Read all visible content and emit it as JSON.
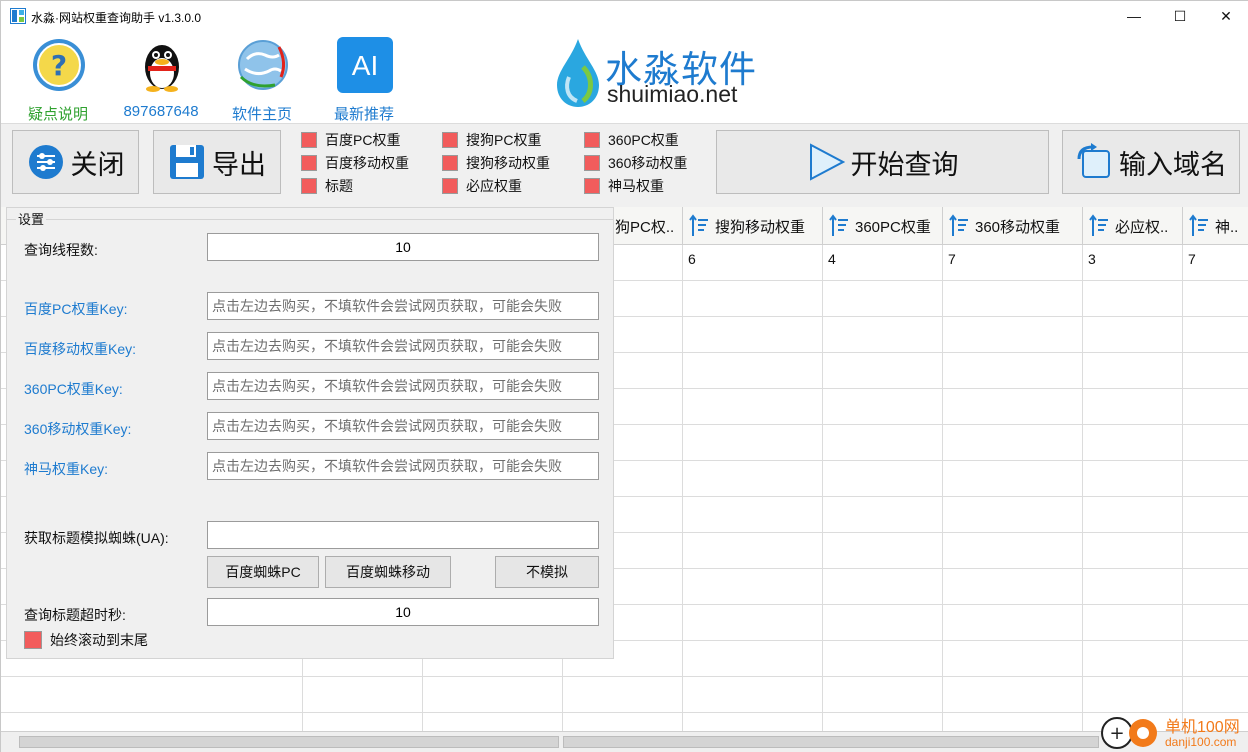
{
  "window": {
    "title": "水淼·网站权重查询助手 v1.3.0.0",
    "controls": {
      "minimize": "—",
      "maximize": "☐",
      "close": "✕"
    }
  },
  "topbar": {
    "items": [
      {
        "label": "疑点说明",
        "icon": "question-icon"
      },
      {
        "label": "897687648",
        "icon": "qq-penguin-icon"
      },
      {
        "label": "软件主页",
        "icon": "globe-icon"
      },
      {
        "label": "最新推荐",
        "icon": "ai-icon",
        "icon_text": "AI"
      }
    ],
    "brand": {
      "cn": "水淼软件",
      "en": "shuimiao.net"
    }
  },
  "toolbar": {
    "close_label": "关闭",
    "export_label": "导出",
    "start_label": "开始查询",
    "input_domain_label": "输入域名",
    "checkboxes": [
      "百度PC权重",
      "百度移动权重",
      "标题",
      "搜狗PC权重",
      "搜狗移动权重",
      "必应权重",
      "360PC权重",
      "360移动权重",
      "神马权重"
    ]
  },
  "table": {
    "headers": [
      "狗PC权..",
      "搜狗移动权重",
      "360PC权重",
      "360移动权重",
      "必应权..",
      "神.."
    ],
    "row1": [
      "6",
      "4",
      "7",
      "3",
      "7"
    ]
  },
  "settings": {
    "legend": "设置",
    "threads_label": "查询线程数:",
    "threads_value": "10",
    "keys": [
      {
        "label": "百度PC权重Key:",
        "placeholder": "点击左边去购买，不填软件会尝试网页获取，可能会失败"
      },
      {
        "label": "百度移动权重Key:",
        "placeholder": "点击左边去购买，不填软件会尝试网页获取，可能会失败"
      },
      {
        "label": "360PC权重Key:",
        "placeholder": "点击左边去购买，不填软件会尝试网页获取，可能会失败"
      },
      {
        "label": "360移动权重Key:",
        "placeholder": "点击左边去购买，不填软件会尝试网页获取，可能会失败"
      },
      {
        "label": "神马权重Key:",
        "placeholder": "点击左边去购买，不填软件会尝试网页获取，可能会失败"
      }
    ],
    "ua_label": "获取标题模拟蜘蛛(UA):",
    "ua_value": "",
    "ua_buttons": [
      "百度蜘蛛PC",
      "百度蜘蛛移动",
      "不模拟"
    ],
    "timeout_label": "查询标题超时秒:",
    "timeout_value": "10",
    "scroll_label": "始终滚动到末尾"
  },
  "watermark": {
    "cn": "单机100网",
    "en": "danji100.com"
  },
  "colors": {
    "accent": "#1e7bcf",
    "checkbox": "#f25c5c",
    "green": "#2fa12f"
  }
}
